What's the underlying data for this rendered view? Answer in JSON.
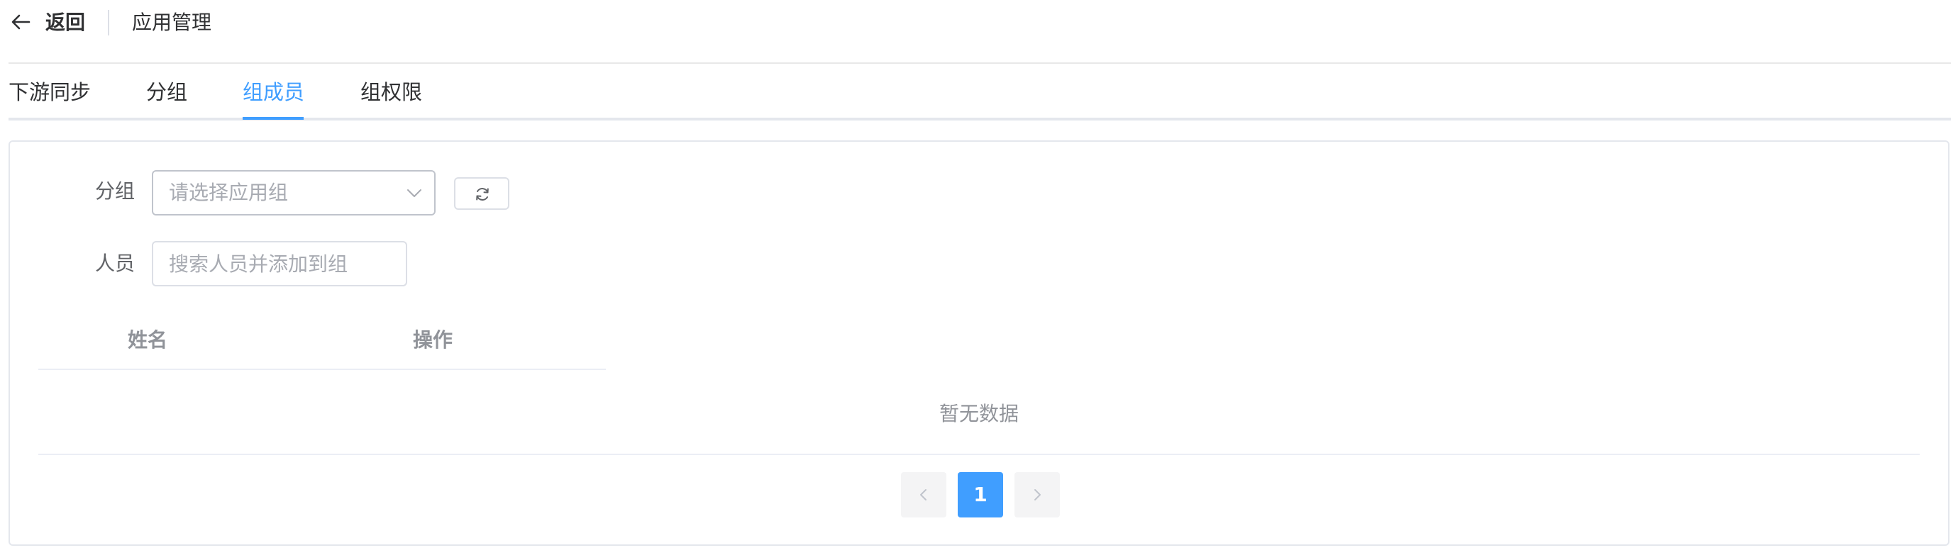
{
  "header": {
    "back_label": "返回",
    "title": "应用管理"
  },
  "tabs": [
    {
      "label": "下游同步",
      "active": false
    },
    {
      "label": "分组",
      "active": false
    },
    {
      "label": "组成员",
      "active": true
    },
    {
      "label": "组权限",
      "active": false
    }
  ],
  "form": {
    "group_label": "分组",
    "group_placeholder": "请选择应用组",
    "group_value": "",
    "person_label": "人员",
    "person_placeholder": "搜索人员并添加到组",
    "person_value": ""
  },
  "table": {
    "columns": [
      "姓名",
      "操作"
    ],
    "rows": [],
    "empty_text": "暂无数据"
  },
  "pagination": {
    "current_page": "1"
  },
  "colors": {
    "accent": "#409eff",
    "text": "#303133",
    "muted": "#909399",
    "border": "#dcdfe6"
  },
  "icons": {
    "back": "arrow-left-icon",
    "select": "chevron-down-icon",
    "refresh": "refresh-icon",
    "prev": "chevron-left-icon",
    "next": "chevron-right-icon"
  }
}
